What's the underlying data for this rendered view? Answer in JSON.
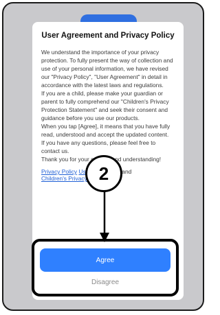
{
  "dialog": {
    "title": "User Agreement and Privacy Policy",
    "paragraphs": [
      "We understand the importance of your privacy protection. To fully present the way of collection and use of your personal information, we have revised our \"Privacy Policy\", \"User Agreement\" in detail in accordance with the latest laws and regulations.",
      "If you are a child, please make your guardian or parent to fully comprehend our \"Children's Privacy Protection Statement\" and seek their consent and guidance before you use our products.",
      "When you tap [Agree], it means that you have fully read, understood and accept the updated content.",
      "If you have any questions, please feel free to contact us.",
      "Thank you for your support and understanding!"
    ],
    "links": {
      "privacy_policy": "Privacy Policy",
      "user_agreement": "User Agreement",
      "and": "and",
      "childrens_statement": "Children's Privacy Statement"
    },
    "agree_label": "Agree",
    "disagree_label": "Disagree"
  },
  "annotation": {
    "step_number": "2"
  },
  "colors": {
    "primary_button": "#2f80ff",
    "link": "#1e5fd6",
    "overlay": "#c9c9cc",
    "annotation": "#000000"
  }
}
